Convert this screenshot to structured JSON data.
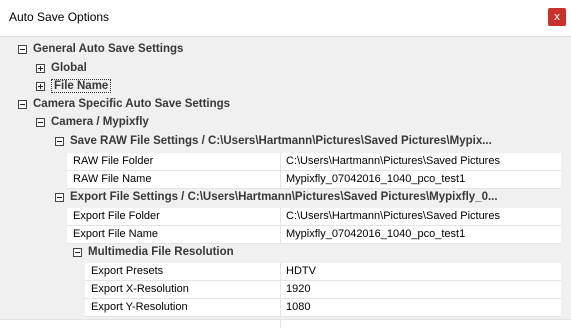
{
  "window": {
    "title": "Auto Save Options",
    "close_label": "x"
  },
  "tree": {
    "general": "General Auto Save Settings",
    "global": "Global",
    "file_name": "File Name",
    "camera_specific": "Camera Specific Auto Save Settings",
    "camera": "Camera / Mypixfly",
    "save_raw": "Save RAW File Settings / C:\\Users\\Hartmann\\Pictures\\Saved Pictures\\Mypix...",
    "export": "Export File Settings / C:\\Users\\Hartmann\\Pictures\\Saved Pictures\\Mypixfly_0...",
    "multimedia": "Multimedia File Resolution"
  },
  "raw_props": [
    {
      "name": "RAW File Folder",
      "value": "C:\\Users\\Hartmann\\Pictures\\Saved Pictures"
    },
    {
      "name": "RAW File Name",
      "value": "Mypixfly_07042016_1040_pco_test1"
    }
  ],
  "export_props": [
    {
      "name": "Export File Folder",
      "value": "C:\\Users\\Hartmann\\Pictures\\Saved Pictures"
    },
    {
      "name": "Export File Name",
      "value": "Mypixfly_07042016_1040_pco_test1"
    }
  ],
  "multimedia_props": [
    {
      "name": "Export Presets",
      "value": "HDTV"
    },
    {
      "name": "Export X-Resolution",
      "value": "1920"
    },
    {
      "name": "Export Y-Resolution",
      "value": "1080"
    }
  ],
  "colors": {
    "close_button": "#c8322b",
    "grid_background": "#f0f0f0",
    "row_background": "#ffffff"
  }
}
